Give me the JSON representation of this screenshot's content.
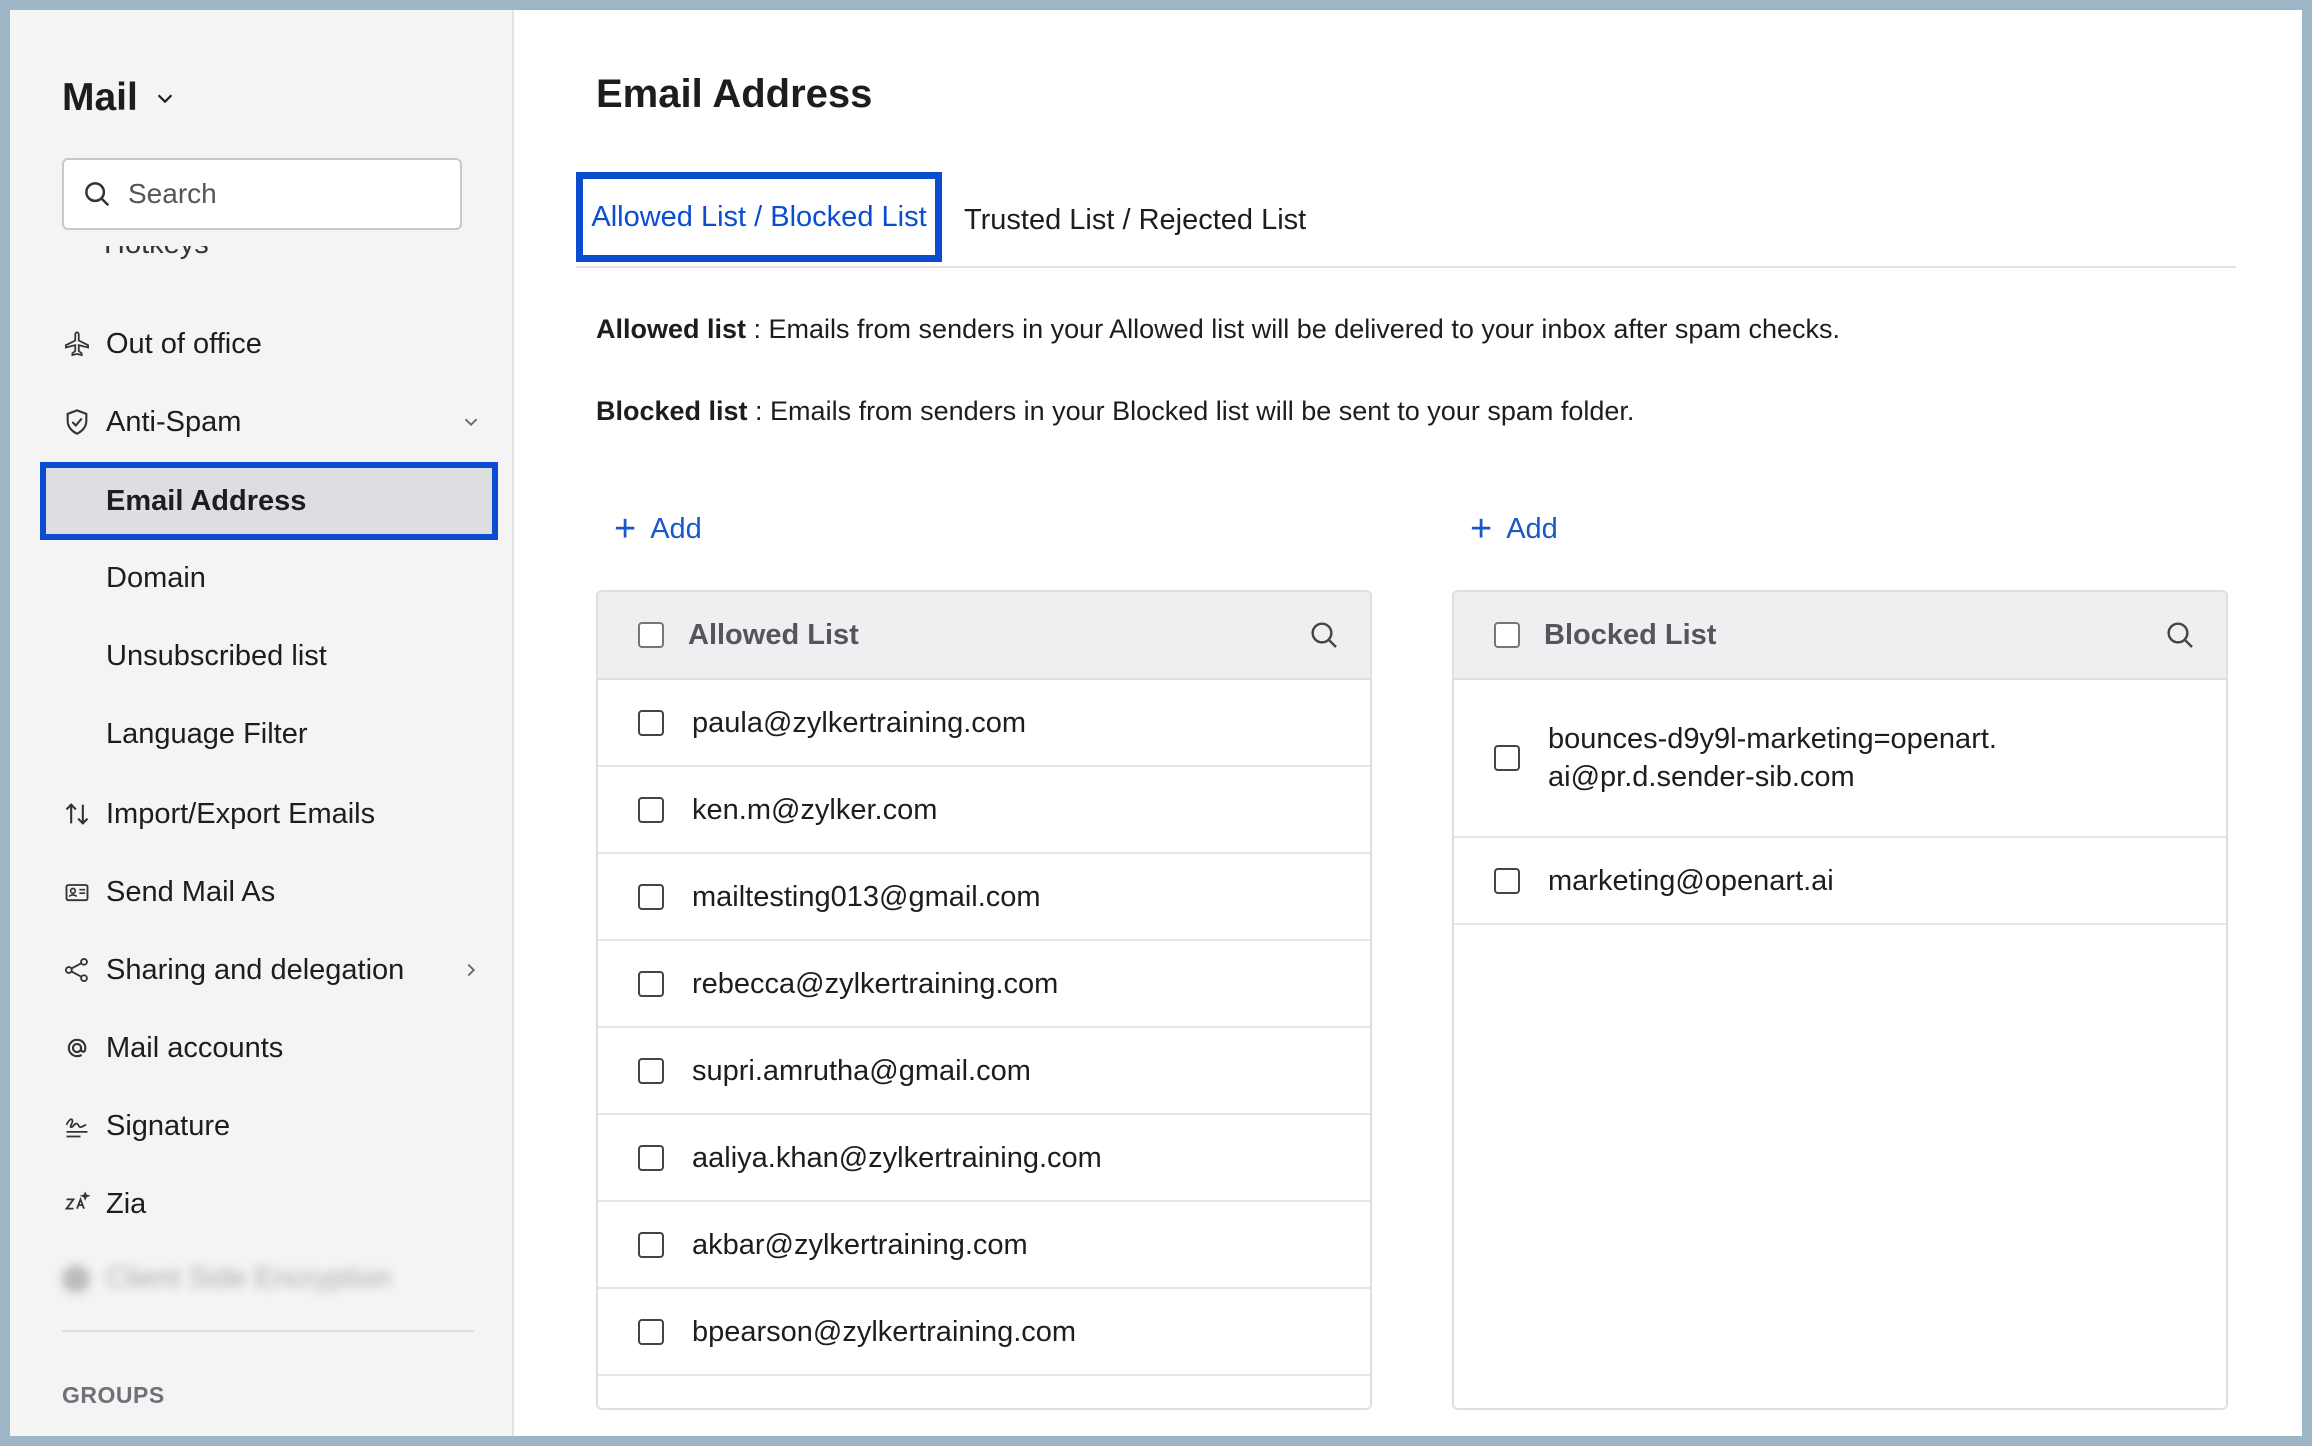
{
  "sidebar": {
    "app_title": "Mail",
    "search_placeholder": "Search",
    "cut_item_label": "Hotkeys",
    "items": [
      {
        "label": "Out of office",
        "icon": "plane-icon"
      },
      {
        "label": "Anti-Spam",
        "icon": "shield-icon"
      },
      {
        "label": "Email Address"
      },
      {
        "label": "Domain"
      },
      {
        "label": "Unsubscribed list"
      },
      {
        "label": "Language Filter"
      },
      {
        "label": "Import/Export Emails",
        "icon": "import-export-icon"
      },
      {
        "label": "Send Mail As",
        "icon": "send-as-icon"
      },
      {
        "label": "Sharing and delegation",
        "icon": "share-icon"
      },
      {
        "label": "Mail accounts",
        "icon": "at-icon"
      },
      {
        "label": "Signature",
        "icon": "signature-icon"
      },
      {
        "label": "Zia",
        "icon": "zia-icon"
      }
    ],
    "blurred_label": "Client Side Encryption",
    "groups_label": "GROUPS"
  },
  "main": {
    "title": "Email Address",
    "tabs": [
      {
        "label": "Allowed List / Blocked List",
        "active": true
      },
      {
        "label": "Trusted List / Rejected List",
        "active": false
      }
    ],
    "allowed_desc_label": "Allowed list",
    "allowed_desc_text": " : Emails from senders in your Allowed list will be delivered to your inbox after spam checks.",
    "blocked_desc_label": "Blocked list",
    "blocked_desc_text": " : Emails from senders in your Blocked list will be sent to your spam folder.",
    "add_label": "Add",
    "allowed_list": {
      "title": "Allowed List",
      "rows": [
        "paula@zylkertraining.com",
        "ken.m@zylker.com",
        "mailtesting013@gmail.com",
        "rebecca@zylkertraining.com",
        "supri.amrutha@gmail.com",
        "aaliya.khan@zylkertraining.com",
        "akbar@zylkertraining.com",
        "bpearson@zylkertraining.com"
      ]
    },
    "blocked_list": {
      "title": "Blocked List",
      "rows": [
        "bounces-d9y9l-marketing=openart.ai@pr.d.sender-sib.com",
        "marketing@openart.ai"
      ]
    }
  },
  "colors": {
    "accent": "#0a4ecf",
    "link": "#1a57c9",
    "sidebar_bg": "#f4f4f5",
    "frame_bg": "#9db6c6"
  }
}
